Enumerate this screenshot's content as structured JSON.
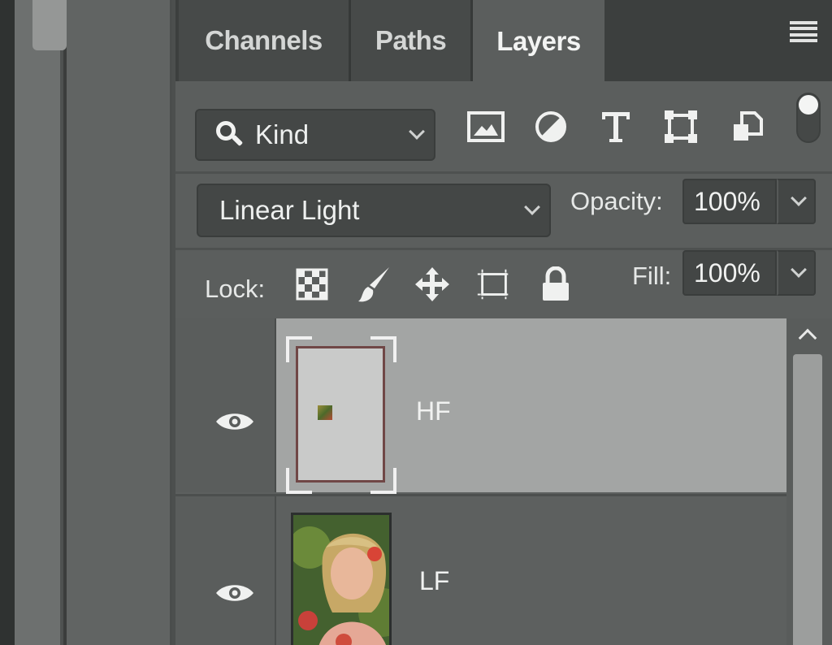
{
  "tabs": [
    {
      "label": "Channels",
      "active": false
    },
    {
      "label": "Paths",
      "active": false
    },
    {
      "label": "Layers",
      "active": true
    }
  ],
  "filter": {
    "kind_label": "Kind",
    "icons": [
      "image-filter-icon",
      "adjustment-filter-icon",
      "type-filter-icon",
      "shape-filter-icon",
      "smart-object-filter-icon"
    ],
    "toggle_on": true
  },
  "blend": {
    "mode": "Linear Light",
    "opacity_label": "Opacity:",
    "opacity_value": "100%"
  },
  "lock": {
    "label": "Lock:",
    "icons": [
      "lock-transparent-pixels-icon",
      "lock-image-pixels-icon",
      "lock-position-icon",
      "lock-artboard-icon",
      "lock-all-icon"
    ],
    "fill_label": "Fill:",
    "fill_value": "100%"
  },
  "layers": [
    {
      "name": "HF",
      "visible": true,
      "selected": true
    },
    {
      "name": "LF",
      "visible": true,
      "selected": false
    }
  ],
  "colors": {
    "panel_bg": "#5b5e5d",
    "selected_layer": "#a3a5a4",
    "tab_bar": "#3c3f3e",
    "input_bg": "#444746"
  }
}
